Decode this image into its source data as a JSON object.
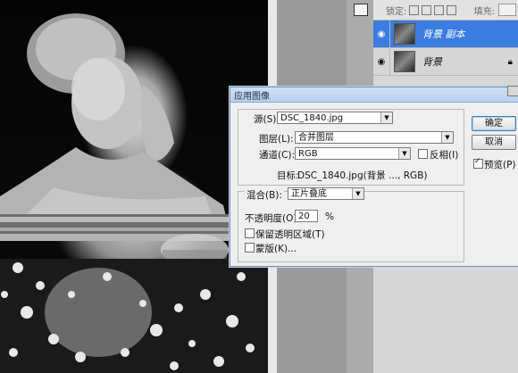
{
  "layers_panel": {
    "lock_label": "锁定:",
    "fill_label": "填充:",
    "layers": [
      {
        "name": "背景 副本",
        "selected": true
      },
      {
        "name": "背景",
        "selected": false
      }
    ]
  },
  "dialog": {
    "title": "应用图像",
    "source_label": "源(S):",
    "source_value": "DSC_1840.jpg",
    "layer_label": "图层(L):",
    "layer_value": "合并图层",
    "channel_label": "通道(C):",
    "channel_value": "RGB",
    "invert_label": "反相(I)",
    "target_label": "目标:",
    "target_value": "DSC_1840.jpg(背景 ..., RGB)",
    "blend_label": "混合(B):",
    "blend_value": "正片叠底",
    "opacity_label": "不透明度(O):",
    "opacity_value": "20",
    "opacity_unit": "%",
    "preserve_label": "保留透明区域(T)",
    "mask_label": "蒙版(K)...",
    "ok_label": "确定",
    "cancel_label": "取消",
    "preview_label": "预览(P)",
    "preview_checked": true,
    "invert_checked": false,
    "preserve_checked": false,
    "mask_checked": false
  }
}
